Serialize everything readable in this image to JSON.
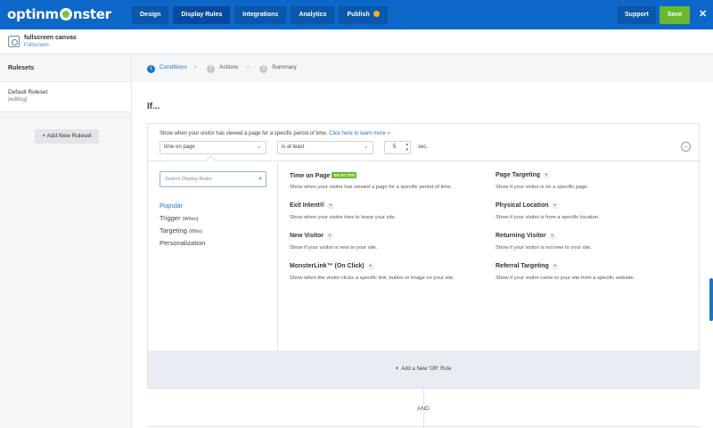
{
  "app": {
    "logo_text": "optinmonster"
  },
  "nav": {
    "tabs": [
      {
        "label": "Design"
      },
      {
        "label": "Display Rules"
      },
      {
        "label": "Integrations"
      },
      {
        "label": "Analytics"
      },
      {
        "label": "Publish"
      }
    ],
    "support_label": "Support",
    "save_label": "Save",
    "close_label": "✕"
  },
  "campaign": {
    "name": "fullscreen canvas",
    "type": "Fullscreen"
  },
  "sidebar": {
    "heading": "Rulesets",
    "items": [
      {
        "name": "Default Ruleset",
        "status": "(editing)"
      }
    ],
    "add_label": "+ Add New Ruleset"
  },
  "steps": [
    {
      "num": "1",
      "label": "Conditions"
    },
    {
      "num": "2",
      "label": "Actions"
    },
    {
      "num": "3",
      "label": "Summary"
    }
  ],
  "main": {
    "if_label": "If...",
    "rule": {
      "description": "Show when your visitor has viewed a page for a specific period of time.",
      "learn_more": "Click here to learn more »",
      "condition_value": "time on page",
      "operator_value": "is at least",
      "number_value": "5",
      "unit": "sec."
    },
    "search_placeholder": "Search Display Rules",
    "categories": [
      {
        "label": "Popular",
        "sub": ""
      },
      {
        "label": "Trigger",
        "sub": "(When)"
      },
      {
        "label": "Targeting",
        "sub": "(Who)"
      },
      {
        "label": "Personalization",
        "sub": ""
      }
    ],
    "options": [
      {
        "title": "Time on Page",
        "badge": "SELECTED",
        "desc": "Show when your visitor has viewed a page for a specific period of time."
      },
      {
        "title": "Page Targeting",
        "desc": "Show if your visitor is on a specific page."
      },
      {
        "title": "Exit Intent®",
        "desc": "Show when your visitor tries to leave your site."
      },
      {
        "title": "Physical Location",
        "desc": "Show if your visitor is from a specific location."
      },
      {
        "title": "New Visitor",
        "desc": "Show if your visitor is new to your site."
      },
      {
        "title": "Returning Visitor",
        "desc": "Show if your visitor is not new to your site."
      },
      {
        "title": "MonsterLink™ (On Click)",
        "desc": "Show when the visitor clicks a specific link, button or image on your site."
      },
      {
        "title": "Referral Targeting",
        "desc": "Show if your visitor came to your site from a specific website."
      }
    ],
    "add_or_label": "Add a New 'OR' Rule",
    "and_label": "AND"
  },
  "colors": {
    "brand_blue": "#0d67c8",
    "save_green": "#6ab92d",
    "link_blue": "#1e74c9"
  }
}
